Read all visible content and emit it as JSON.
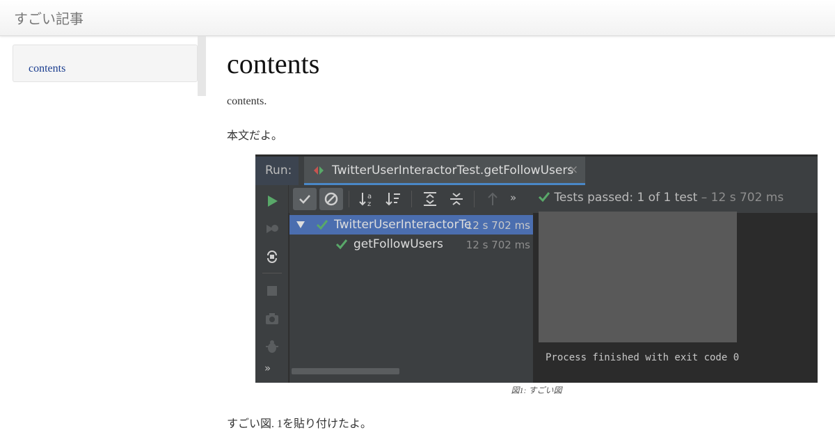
{
  "header": {
    "site_title": "すごい記事"
  },
  "sidebar": {
    "toc": [
      {
        "label": "contents"
      }
    ]
  },
  "article": {
    "title": "contents",
    "paragraphs": [
      "contents.",
      "本文だよ。",
      "すごい図. 1を貼り付けたよ。"
    ],
    "figure_caption": "図1: すごい図"
  },
  "ide": {
    "run_label": "Run:",
    "tab": {
      "label": "TwitterUserInteractorTest.getFollowUsers",
      "close_glyph": "×",
      "icon": "test-result-icon"
    },
    "toolbar": {
      "buttons": [
        "show-passed-icon",
        "show-ignored-icon",
        "sort-alpha-icon",
        "sort-duration-icon",
        "expand-all-icon",
        "collapse-all-icon",
        "previous-failed-icon",
        "more-icon"
      ],
      "more_glyph": "»",
      "status_prefix": "Tests passed:",
      "status_count": "1 of 1 test",
      "status_time": "– 12 s 702 ms"
    },
    "tree": [
      {
        "label": "TwitterUserInteractorTe",
        "time": "12 s 702 ms",
        "expanded": true,
        "selected": true
      },
      {
        "label": "getFollowUsers",
        "time": "12 s 702 ms",
        "selected": false
      }
    ],
    "left_strip_more_glyph": "»",
    "console_output": "Process finished with exit code 0",
    "colors": {
      "pass_green": "#59a869",
      "selection": "#4b6eaf",
      "panel": "#3c3f41",
      "editor": "#2b2b2b"
    }
  }
}
